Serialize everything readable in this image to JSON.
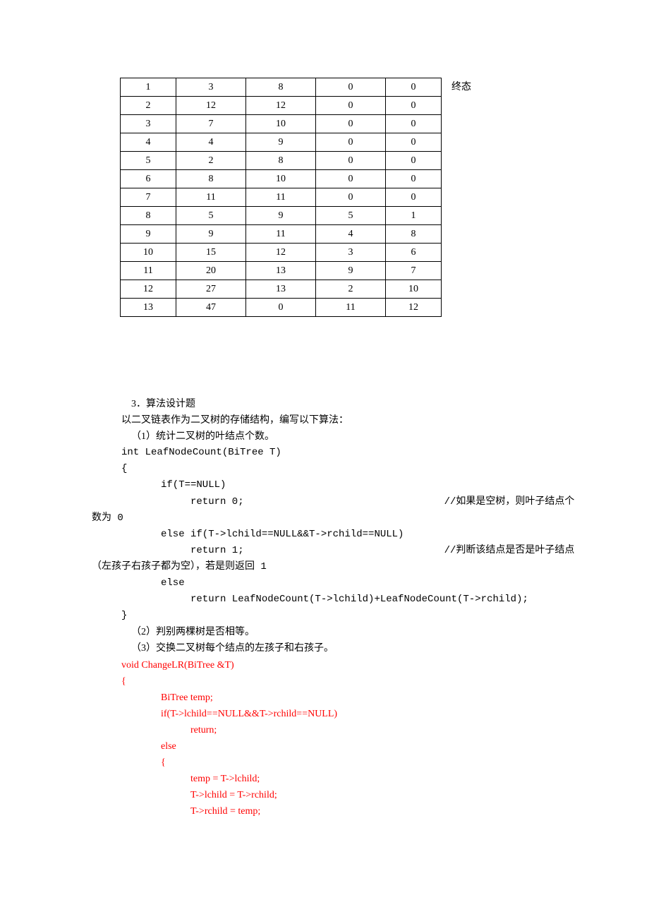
{
  "chart_data": {
    "type": "table",
    "rows": [
      [
        "1",
        "3",
        "8",
        "0",
        "0"
      ],
      [
        "2",
        "12",
        "12",
        "0",
        "0"
      ],
      [
        "3",
        "7",
        "10",
        "0",
        "0"
      ],
      [
        "4",
        "4",
        "9",
        "0",
        "0"
      ],
      [
        "5",
        "2",
        "8",
        "0",
        "0"
      ],
      [
        "6",
        "8",
        "10",
        "0",
        "0"
      ],
      [
        "7",
        "11",
        "11",
        "0",
        "0"
      ],
      [
        "8",
        "5",
        "9",
        "5",
        "1"
      ],
      [
        "9",
        "9",
        "11",
        "4",
        "8"
      ],
      [
        "10",
        "15",
        "12",
        "3",
        "6"
      ],
      [
        "11",
        "20",
        "13",
        "9",
        "7"
      ],
      [
        "12",
        "27",
        "13",
        "2",
        "10"
      ],
      [
        "13",
        "47",
        "0",
        "11",
        "12"
      ]
    ]
  },
  "table_annotation": "终态",
  "section_title": "3．算法设计题",
  "desc_storage": "以二叉链表作为二叉树的存储结构，编写以下算法：",
  "q1_label": "（1）统计二叉树的叶结点个数。",
  "code1_sig": "int LeafNodeCount(BiTree T)",
  "code1_open": "{",
  "code1_if": "if(T==NULL)",
  "code1_ret0": "return 0;",
  "code1_cmt1a": "//如果是空树，则叶子结点个",
  "code1_cmt1b": "数为 0",
  "code1_elseif": "else if(T->lchild==NULL&&T->rchild==NULL)",
  "code1_ret1": "return 1;",
  "code1_cmt2a": "//判断该结点是否是叶子结点",
  "code1_cmt2b": "（左孩子右孩子都为空），若是则返回 1",
  "code1_else": "else",
  "code1_retrec": "return LeafNodeCount(T->lchild)+LeafNodeCount(T->rchild);",
  "code1_close": "}",
  "q2_label": "（2）判别两棵树是否相等。",
  "q3_label": "（3）交换二叉树每个结点的左孩子和右孩子。",
  "code3_sig": "void ChangeLR(BiTree &T)",
  "code3_open": "{",
  "code3_decl": "BiTree temp;",
  "code3_if": "if(T->lchild==NULL&&T->rchild==NULL)",
  "code3_ret": "return;",
  "code3_else": "else",
  "code3_bopen": "{",
  "code3_s1": "temp = T->lchild;",
  "code3_s2": "T->lchild = T->rchild;",
  "code3_s3": "T->rchild = temp;"
}
